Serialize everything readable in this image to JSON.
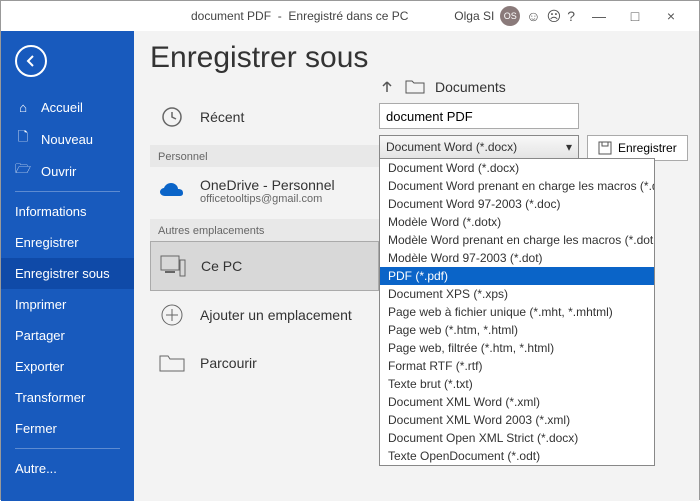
{
  "title": {
    "doc": "document PDF",
    "status": "Enregistré dans ce PC",
    "user": "Olga SI",
    "initials": "OS"
  },
  "page_title": "Enregistrer sous",
  "sidebar": {
    "items": [
      {
        "label": "Accueil"
      },
      {
        "label": "Nouveau"
      },
      {
        "label": "Ouvrir"
      },
      {
        "label": "Informations"
      },
      {
        "label": "Enregistrer"
      },
      {
        "label": "Enregistrer sous"
      },
      {
        "label": "Imprimer"
      },
      {
        "label": "Partager"
      },
      {
        "label": "Exporter"
      },
      {
        "label": "Transformer"
      },
      {
        "label": "Fermer"
      },
      {
        "label": "Autre..."
      }
    ]
  },
  "locations": {
    "recent": "Récent",
    "sect_personal": "Personnel",
    "onedrive": {
      "name": "OneDrive - Personnel",
      "email": "officetooltips@gmail.com"
    },
    "sect_other": "Autres emplacements",
    "thispc": "Ce PC",
    "addplace": "Ajouter un emplacement",
    "browse": "Parcourir"
  },
  "path": {
    "folder": "Documents"
  },
  "filename": "document PDF",
  "combo_selected": "Document Word (*.docx)",
  "save_label": "Enregistrer",
  "formats": [
    "Document Word (*.docx)",
    "Document Word prenant en charge les macros (*.docm)",
    "Document Word 97-2003 (*.doc)",
    "Modèle Word (*.dotx)",
    "Modèle Word prenant en charge les macros (*.dotm)",
    "Modèle Word 97-2003 (*.dot)",
    "PDF (*.pdf)",
    "Document XPS (*.xps)",
    "Page web à fichier unique (*.mht, *.mhtml)",
    "Page web (*.htm, *.html)",
    "Page web, filtrée (*.htm, *.html)",
    "Format RTF (*.rtf)",
    "Texte brut (*.txt)",
    "Document XML Word (*.xml)",
    "Document XML Word 2003 (*.xml)",
    "Document Open XML Strict (*.docx)",
    "Texte OpenDocument (*.odt)"
  ],
  "selected_format_index": 6
}
